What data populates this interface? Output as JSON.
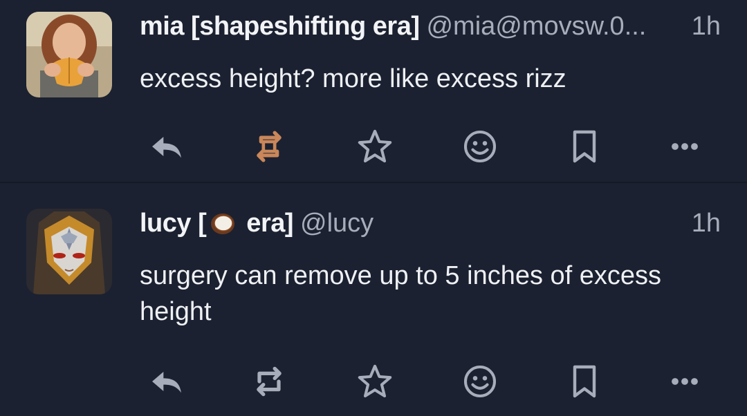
{
  "colors": {
    "background": "#1b2130",
    "icon_default": "#a7adba",
    "icon_boosted": "#c9875a",
    "text_primary": "#eef0f4",
    "text_secondary": "#a7adba"
  },
  "posts": [
    {
      "display_name": "mia [shapeshifting era]",
      "handle": "@mia@movsw.0...",
      "time": "1h",
      "content": "excess height? more like excess rizz",
      "boosted": true,
      "actions": [
        "reply-icon",
        "boost-icon",
        "star-icon",
        "emoji-react-icon",
        "bookmark-icon",
        "more-icon"
      ]
    },
    {
      "display_name_prefix": "lucy [",
      "display_name_emoji": "coconut-emoji",
      "display_name_suffix": " era]",
      "handle": "@lucy",
      "time": "1h",
      "content": "surgery can remove up to 5 inches of excess height",
      "boosted": false,
      "actions": [
        "reply-icon",
        "boost-icon",
        "star-icon",
        "emoji-react-icon",
        "bookmark-icon",
        "more-icon"
      ]
    }
  ]
}
